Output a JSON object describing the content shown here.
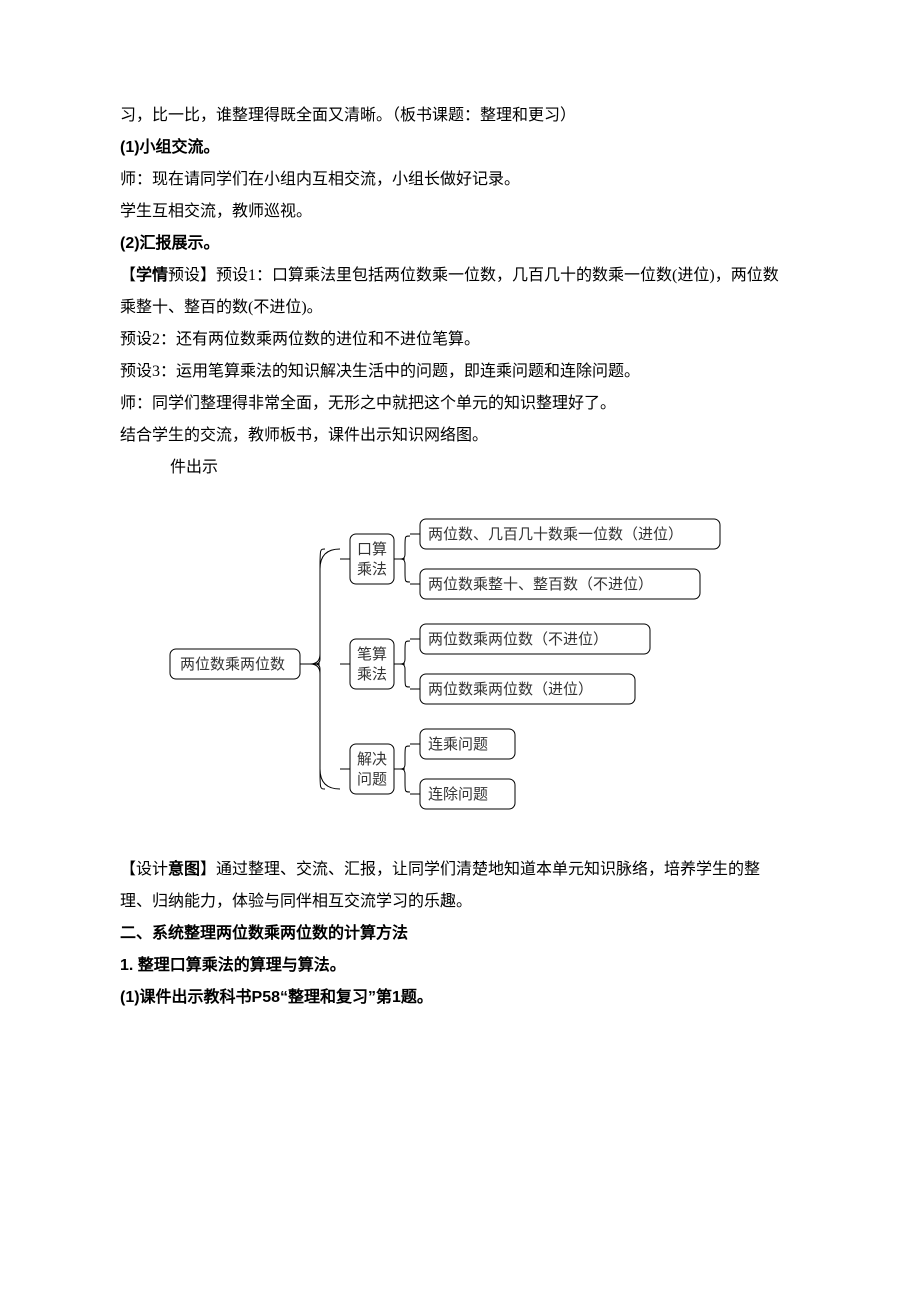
{
  "p1": "习，比一比，谁整理得既全面又清晰。（板书课题：整理和更习）",
  "p2": "(1)小组交流。",
  "p3": "师：现在请同学们在小组内互相交流，小组长做好记录。",
  "p4": "学生互相交流，教师巡视。",
  "p5": "(2)汇报展示。",
  "p6a": "【",
  "p6b": "学情",
  "p6c": "预设】预设1：口算乘法里包括两位数乘一位数，几百几十的数乘一位数(进位)，两位数",
  "p7": "乘整十、整百的数(不进位)。",
  "p8": "预设2：还有两位数乘两位数的进位和不进位笔算。",
  "p9": "预设3：运用笔算乘法的知识解决生活中的问题，即连乘问题和连除问题。",
  "p10": "师：同学们整理得非常全面，无形之中就把这个单元的知识整理好了。",
  "p11": "结合学生的交流，教师板书，课件出示知识网络图。",
  "pslide": "件出示",
  "diagram": {
    "root": "两位数乘两位数",
    "b1": {
      "label1": "口算",
      "label2": "乘法",
      "leaf1": "两位数、几百几十数乘一位数（进位）",
      "leaf2": "两位数乘整十、整百数（不进位）"
    },
    "b2": {
      "label1": "笔算",
      "label2": "乘法",
      "leaf1": "两位数乘两位数（不进位）",
      "leaf2": "两位数乘两位数（进位）"
    },
    "b3": {
      "label1": "解决",
      "label2": "问题",
      "leaf1": "连乘问题",
      "leaf2": "连除问题"
    }
  },
  "d1a": "【设计",
  "d1b": "意图",
  "d1c": "】通过整理、交流、汇报，让同学们清楚地知道本单元知识脉络，培养学生的整",
  "d2": "理、归纳能力，体验与同伴相互交流学习的乐趣。",
  "h2": "二、系统整理两位数乘两位数的计算方法",
  "s1": "1. 整理口算乘法的算理与算法。",
  "s2": "(1)课件出示教科书P58“整理和复习”第1题。"
}
